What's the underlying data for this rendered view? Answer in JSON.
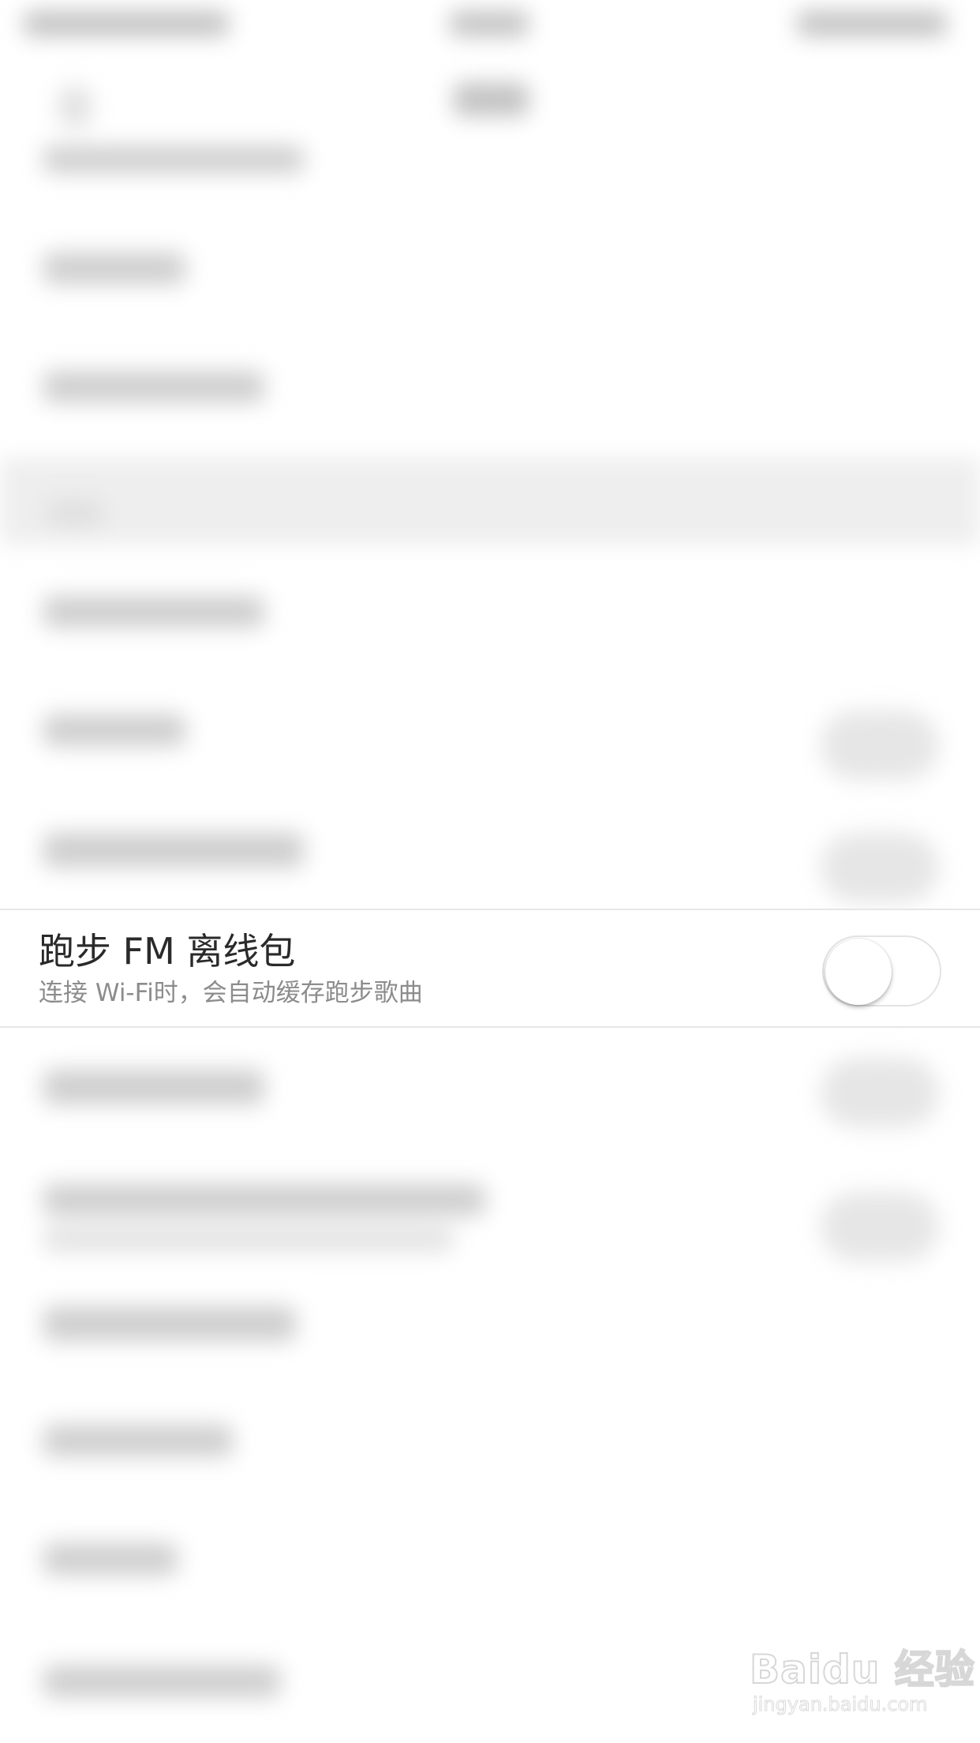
{
  "row": {
    "title": "跑步 FM 离线包",
    "subtitle": "连接 Wi-Fi时，会自动缓存跑步歌曲",
    "toggle_on": false
  },
  "watermark": {
    "brand": "Baidu 经验",
    "url": "jingyan.baidu.com"
  },
  "colors": {
    "background": "#ffffff",
    "title": "#2a2a2a",
    "subtitle": "#8c8c8c",
    "divider": "#e6e6e6"
  }
}
